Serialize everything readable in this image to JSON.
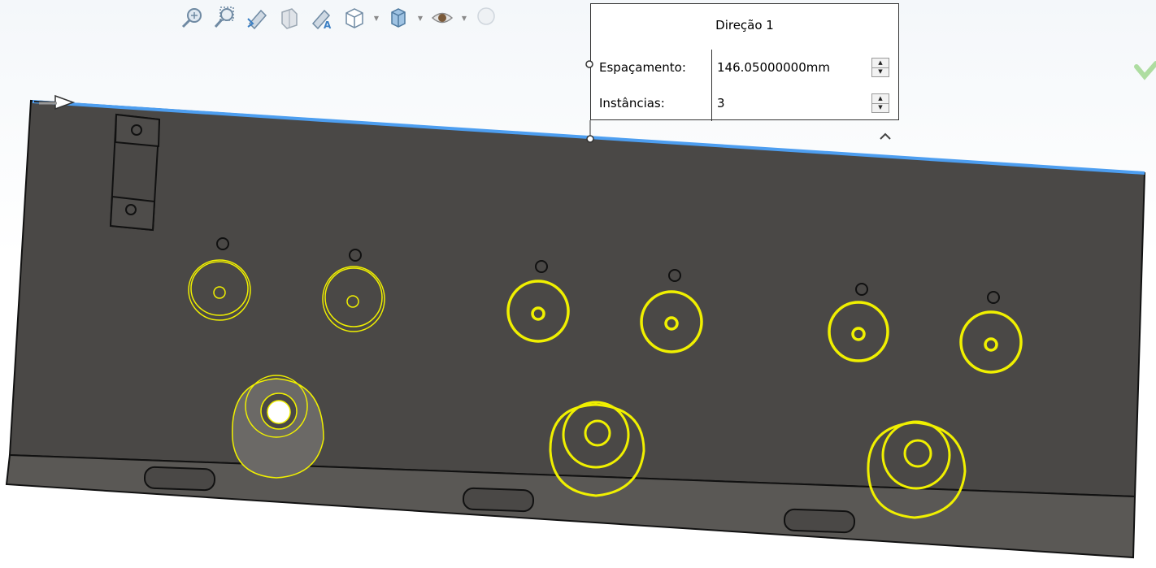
{
  "toolbar": {
    "items": [
      {
        "icon": "zoom-to-fit-icon",
        "has_dropdown": false
      },
      {
        "icon": "zoom-to-area-icon",
        "has_dropdown": false
      },
      {
        "icon": "previous-view-icon",
        "has_dropdown": false
      },
      {
        "icon": "section-view-icon",
        "has_dropdown": false
      },
      {
        "icon": "dynamic-annotation-views-icon",
        "has_dropdown": false
      },
      {
        "icon": "view-orientation-icon",
        "has_dropdown": true
      },
      {
        "icon": "display-style-icon",
        "has_dropdown": true
      },
      {
        "icon": "hide-show-items-icon",
        "has_dropdown": true
      },
      {
        "icon": "edit-appearance-icon",
        "has_dropdown": false
      }
    ]
  },
  "callout": {
    "title": "Direção 1",
    "spacing": {
      "label": "Espaçamento:",
      "value": "146.05000000mm"
    },
    "instances": {
      "label": "Instâncias:",
      "value": "3"
    }
  },
  "colors": {
    "part_face": "#4a4846",
    "part_front": "#5a5855",
    "part_edge": "#111111",
    "selected_edge": "#4d9ef0",
    "preview_highlight": "#f0f000",
    "toolbar_icon": "#6f8aa3",
    "confirm_accent": "#8fd17a"
  },
  "confirm_icon": "checkmark-icon"
}
